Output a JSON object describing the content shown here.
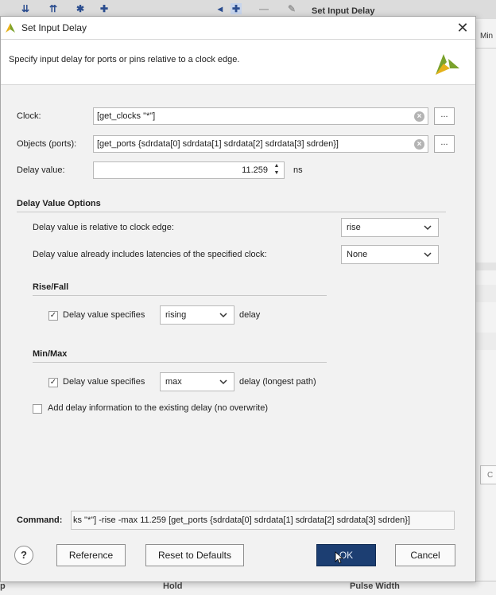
{
  "background": {
    "toolbar_title": "Set Input Delay",
    "right_header": "Min",
    "right_box_text": "C",
    "bottom_labels": [
      "p",
      "Hold",
      "Pulse Width"
    ]
  },
  "dialog": {
    "title": "Set Input Delay",
    "description": "Specify input delay for ports or pins relative to a clock edge.",
    "clock": {
      "label": "Clock:",
      "value": "[get_clocks  \"*\"]"
    },
    "objects": {
      "label": "Objects (ports):",
      "value": "[get_ports {sdrdata[0] sdrdata[1] sdrdata[2] sdrdata[3] sdrden}]"
    },
    "delay": {
      "label": "Delay value:",
      "value": "11.259",
      "unit": "ns"
    },
    "options": {
      "title": "Delay Value Options",
      "edge_label": "Delay value is relative to clock edge:",
      "edge_value": "rise",
      "latency_label": "Delay value already includes latencies of the specified clock:",
      "latency_value": "None"
    },
    "rise_fall": {
      "title": "Rise/Fall",
      "checkbox_label": "Delay value specifies",
      "select_value": "rising",
      "suffix": "delay",
      "checked": true
    },
    "min_max": {
      "title": "Min/Max",
      "checkbox_label": "Delay value specifies",
      "select_value": "max",
      "suffix": "delay (longest path)",
      "checked": true
    },
    "add_delay": {
      "label": "Add delay information to the existing delay (no overwrite)",
      "checked": false
    },
    "command": {
      "label": "Command:",
      "value": "ks  \"*\"] -rise -max 11.259 [get_ports {sdrdata[0] sdrdata[1] sdrdata[2] sdrdata[3] sdrden}]"
    },
    "buttons": {
      "help": "?",
      "reference": "Reference",
      "reset": "Reset to Defaults",
      "ok": "OK",
      "cancel": "Cancel"
    }
  },
  "colors": {
    "ok_button": "#1c3e72",
    "logo_yellow": "#e5b21b",
    "logo_green": "#7aa22c"
  }
}
